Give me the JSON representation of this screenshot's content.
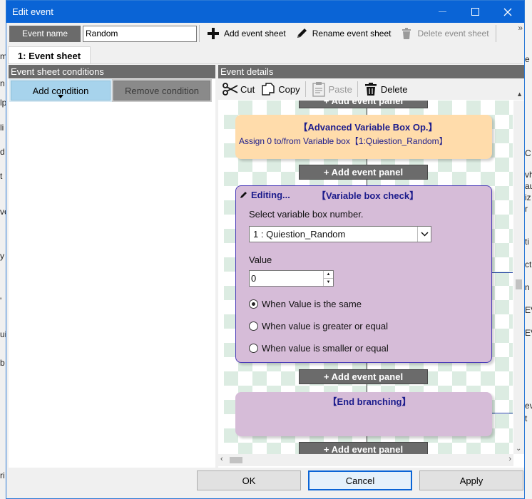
{
  "window": {
    "title": "Edit event"
  },
  "toolbar": {
    "event_name_label": "Event name",
    "event_name_value": "Random",
    "add_event_sheet": "Add event sheet",
    "rename_event_sheet": "Rename event sheet",
    "delete_event_sheet": "Delete event sheet",
    "overflow": "»"
  },
  "tabs": [
    {
      "label": "1: Event sheet"
    }
  ],
  "left_pane": {
    "header": "Event sheet conditions",
    "add_condition": "Add condition",
    "remove_condition": "Remove condition"
  },
  "right_pane": {
    "header": "Event details",
    "cut": "Cut",
    "copy": "Copy",
    "paste": "Paste",
    "delete": "Delete"
  },
  "canvas": {
    "add_event_panel": "+ Add event panel",
    "panel1": {
      "title": "【Advanced Variable Box Op.】",
      "desc": "Assign 0 to/from Variable box【1:Quiestion_Random】"
    },
    "panel2": {
      "editing": "Editing...",
      "title": "【Variable box check】",
      "select_label": "Select variable box number.",
      "select_value": "1 : Quiestion_Random",
      "value_label": "Value",
      "value": "0",
      "radio_same": "When Value is the same",
      "radio_greater": "When value is greater or equal",
      "radio_smaller": "When value is smaller or equal"
    },
    "panel3": {
      "title": "【End branching】"
    }
  },
  "footer": {
    "ok": "OK",
    "cancel": "Cancel",
    "apply": "Apply"
  },
  "background": {
    "left_fragments": [
      "m",
      "n",
      "lp",
      "li",
      "d",
      "t",
      "ve",
      "y",
      "'",
      "ui",
      "b",
      "ri"
    ],
    "right_fragments": [
      "e",
      "C",
      "vh",
      "au",
      "iz",
      "r",
      "ti",
      "ct",
      "n",
      "EV",
      "EV",
      "ev",
      "t"
    ]
  }
}
